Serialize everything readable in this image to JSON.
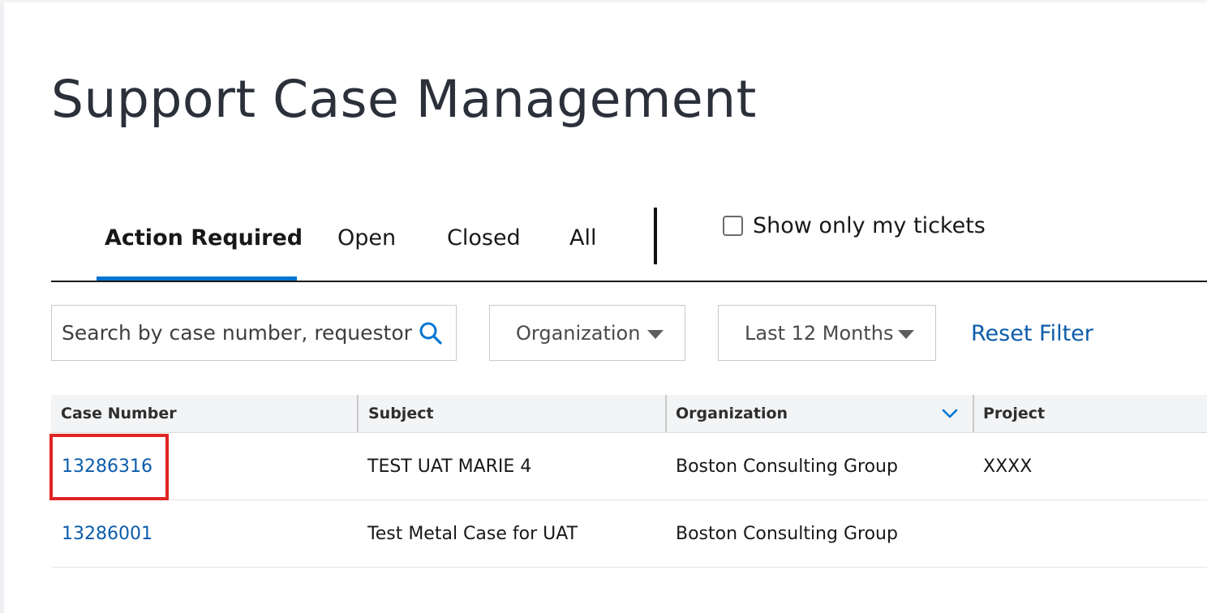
{
  "page": {
    "title": "Support Case Management"
  },
  "tabs": [
    {
      "label": "Action Required",
      "active": true
    },
    {
      "label": "Open",
      "active": false
    },
    {
      "label": "Closed",
      "active": false
    },
    {
      "label": "All",
      "active": false
    }
  ],
  "my_tickets": {
    "label": "Show only my tickets",
    "checked": false
  },
  "filters": {
    "search_placeholder": "Search by case number, requestor",
    "organization_label": "Organization",
    "date_range_label": "Last 12 Months",
    "reset_label": "Reset Filter"
  },
  "table": {
    "columns": [
      "Case Number",
      "Subject",
      "Organization",
      "Project"
    ],
    "rows": [
      {
        "case_number": "13286316",
        "subject": "TEST UAT MARIE 4",
        "organization": "Boston Consulting Group",
        "project": "XXXX"
      },
      {
        "case_number": "13286001",
        "subject": "Test Metal Case for UAT",
        "organization": "Boston Consulting Group",
        "project": ""
      }
    ]
  },
  "colors": {
    "accent": "#0176d3",
    "link": "#0b5cab",
    "highlight": "#e02424"
  }
}
